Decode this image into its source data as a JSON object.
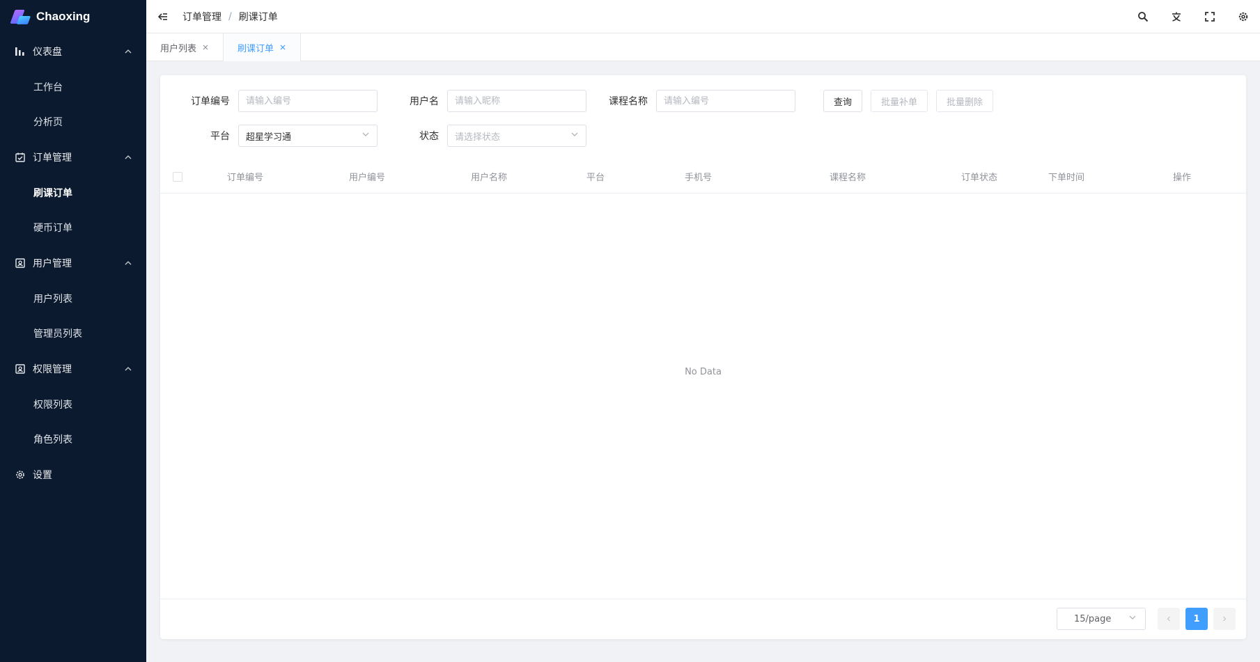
{
  "app": {
    "brand": "Chaoxing"
  },
  "sidebar": {
    "groups": [
      {
        "label": "仪表盘",
        "icon": "bar-chart-icon",
        "items": [
          "工作台",
          "分析页"
        ]
      },
      {
        "label": "订单管理",
        "icon": "calendar-check-icon",
        "items": [
          "刷课订单",
          "硬币订单"
        ]
      },
      {
        "label": "用户管理",
        "icon": "user-card-icon",
        "items": [
          "用户列表",
          "管理员列表"
        ]
      },
      {
        "label": "权限管理",
        "icon": "user-card-icon",
        "items": [
          "权限列表",
          "角色列表"
        ]
      },
      {
        "label": "设置",
        "icon": "gear-icon",
        "items": []
      }
    ],
    "active_item": "刷课订单"
  },
  "header": {
    "breadcrumb": [
      "订单管理",
      "刷课订单"
    ],
    "breadcrumb_separator": "/",
    "tools": [
      "search-icon",
      "translate-icon",
      "fullscreen-icon",
      "gear-icon"
    ]
  },
  "tabs": [
    {
      "label": "用户列表",
      "active": false
    },
    {
      "label": "刷课订单",
      "active": true
    }
  ],
  "filters": {
    "order_no": {
      "label": "订单编号",
      "placeholder": "请输入编号",
      "value": ""
    },
    "username": {
      "label": "用户名",
      "placeholder": "请输入昵称",
      "value": ""
    },
    "course_name": {
      "label": "课程名称",
      "placeholder": "请输入编号",
      "value": ""
    },
    "platform": {
      "label": "平台",
      "value": "超星学习通"
    },
    "status": {
      "label": "状态",
      "placeholder": "请选择状态"
    }
  },
  "buttons": {
    "query": "查询",
    "batch_resubmit": "批量补单",
    "batch_delete": "批量删除"
  },
  "table": {
    "columns": [
      "订单编号",
      "用户编号",
      "用户名称",
      "平台",
      "手机号",
      "课程名称",
      "订单状态",
      "下单时间",
      "操作"
    ],
    "rows": [],
    "empty_text": "No Data"
  },
  "pagination": {
    "page_size": "15/page",
    "current_page": "1"
  },
  "colors": {
    "sidebar_bg": "#0b1a2e",
    "accent": "#409eff",
    "page_bg": "#f0f2f5"
  }
}
